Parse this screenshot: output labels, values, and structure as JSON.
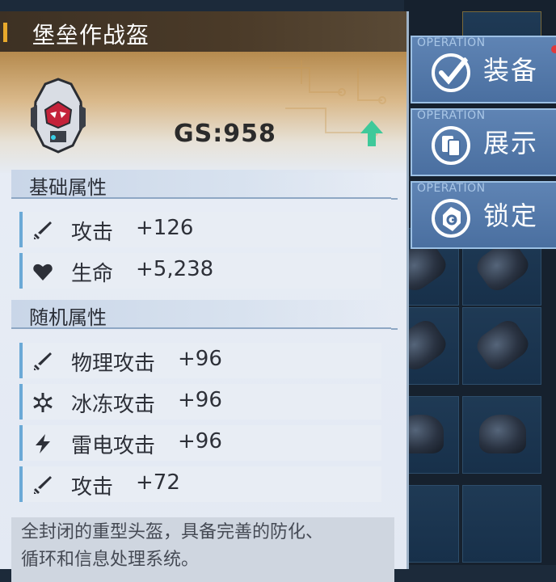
{
  "item": {
    "title": "堡垒作战盔",
    "gs": "GS:958",
    "icon": "helmet-icon",
    "upgrade_icon": "green-up-arrow-icon"
  },
  "sections": {
    "basic": {
      "title": "基础属性",
      "stats": [
        {
          "icon": "sword-icon",
          "name": "攻击",
          "value": "+126"
        },
        {
          "icon": "heart-icon",
          "name": "生命",
          "value": "+5,238"
        }
      ]
    },
    "random": {
      "title": "随机属性",
      "stats": [
        {
          "icon": "sword-icon",
          "name": "物理攻击",
          "value": "+96"
        },
        {
          "icon": "snowflake-icon",
          "name": "冰冻攻击",
          "value": "+96"
        },
        {
          "icon": "lightning-icon",
          "name": "雷电攻击",
          "value": "+96"
        },
        {
          "icon": "sword-icon",
          "name": "攻击",
          "value": "+72"
        }
      ]
    }
  },
  "description": {
    "line1": "全封闭的重型头盔，具备完善的防化、",
    "line2": "循环和信息处理系统。"
  },
  "actions": [
    {
      "op": "OPERATION",
      "label": "装备",
      "icon": "check-icon"
    },
    {
      "op": "OPERATION",
      "label": "展示",
      "icon": "cards-icon"
    },
    {
      "op": "OPERATION",
      "label": "锁定",
      "icon": "lock-tag-icon"
    }
  ],
  "colors": {
    "accent": "#e8a92c",
    "stat_bar": "#6ba9d6",
    "action_button": "#4a6fa0",
    "upgrade_arrow": "#3fc99a",
    "notification": "#e0383a"
  }
}
